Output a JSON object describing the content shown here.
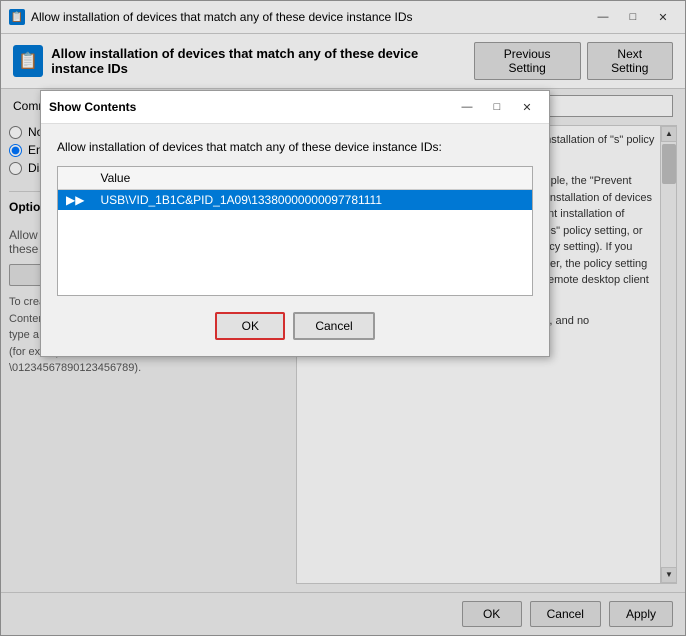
{
  "mainWindow": {
    "title": "Allow installation of devices that match any of these device instance IDs",
    "icon": "📋"
  },
  "header": {
    "title": "Allow installation of devices that match any of these device instance IDs",
    "previousButton": "Previous Setting",
    "nextButton": "Next Setting"
  },
  "comment": {
    "label": "Comment:"
  },
  "radioOptions": [
    {
      "id": "not-configured",
      "label": "Not Configured",
      "checked": false
    },
    {
      "id": "enabled",
      "label": "Enabled",
      "checked": true
    },
    {
      "id": "disabled",
      "label": "Disabled",
      "checked": false
    }
  ],
  "options": {
    "label": "Options:",
    "allowInstallLabel": "Allow installation of devices that match any of these device instance IDs:",
    "showButton": "Show...",
    "helpTexts": [
      "To create a list of device instance IDs, click Show Contents",
      "type a P",
      "(for example, USB\\VID_0781&PID_5521\\20060413130000000000 or \\0123456789012345678901234567890)."
    ]
  },
  "description": {
    "paragraphs": [
      "t of Plug and Play devices is allowed to install. nt installation of \"s\" policy setting is device installation",
      "allowed to install or ice instance ID policy setting mple, the \"Prevent installation of devices\" policy setting, the \"Prevent installation of devices for these device classes\" policy setting, the \"Prevent installation of devices that match any of these device instance IDs\" policy setting, or the \"Prevent installation of removable devices\" policy setting). If you enable this policy setting on a remote desktop server, the policy setting affects redirection of the specified devices from a remote desktop client to the remote desktop server.",
      "If you disable or do not configure this policy setting, and no"
    ]
  },
  "bottomButtons": {
    "ok": "OK",
    "cancel": "Cancel",
    "apply": "Apply"
  },
  "dialog": {
    "title": "Show Contents",
    "description": "Allow installation of devices that match any of these device instance IDs:",
    "table": {
      "valueColumn": "Value",
      "rows": [
        {
          "value": "USB\\VID_1B1C&PID_1A09\\13380000000097781111",
          "selected": true
        }
      ],
      "moveArrow": "▶▶"
    },
    "okButton": "OK",
    "cancelButton": "Cancel"
  },
  "titleBarButtons": {
    "minimize": "—",
    "maximize": "□",
    "close": "✕"
  }
}
